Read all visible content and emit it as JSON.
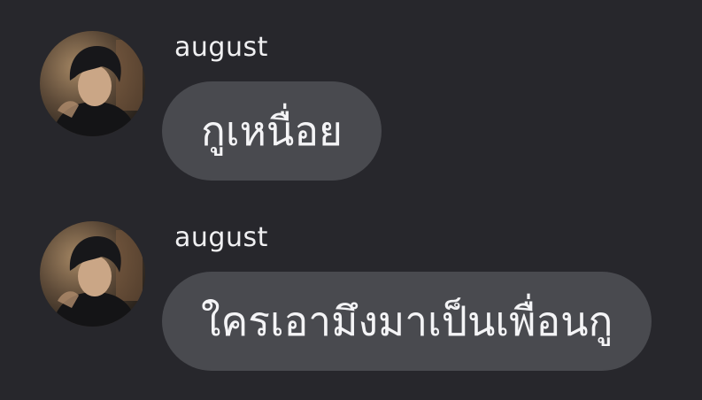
{
  "conversation": {
    "messages": [
      {
        "sender": "august",
        "text": "กูเหนื่อย",
        "avatar_icon": "user-photo-avatar"
      },
      {
        "sender": "august",
        "text": "ใครเอามึงมาเป็นเพื่อนกู",
        "avatar_icon": "user-photo-avatar"
      }
    ]
  },
  "colors": {
    "background": "#27272c",
    "bubble": "#494a4f",
    "text": "#f4f4f6"
  }
}
